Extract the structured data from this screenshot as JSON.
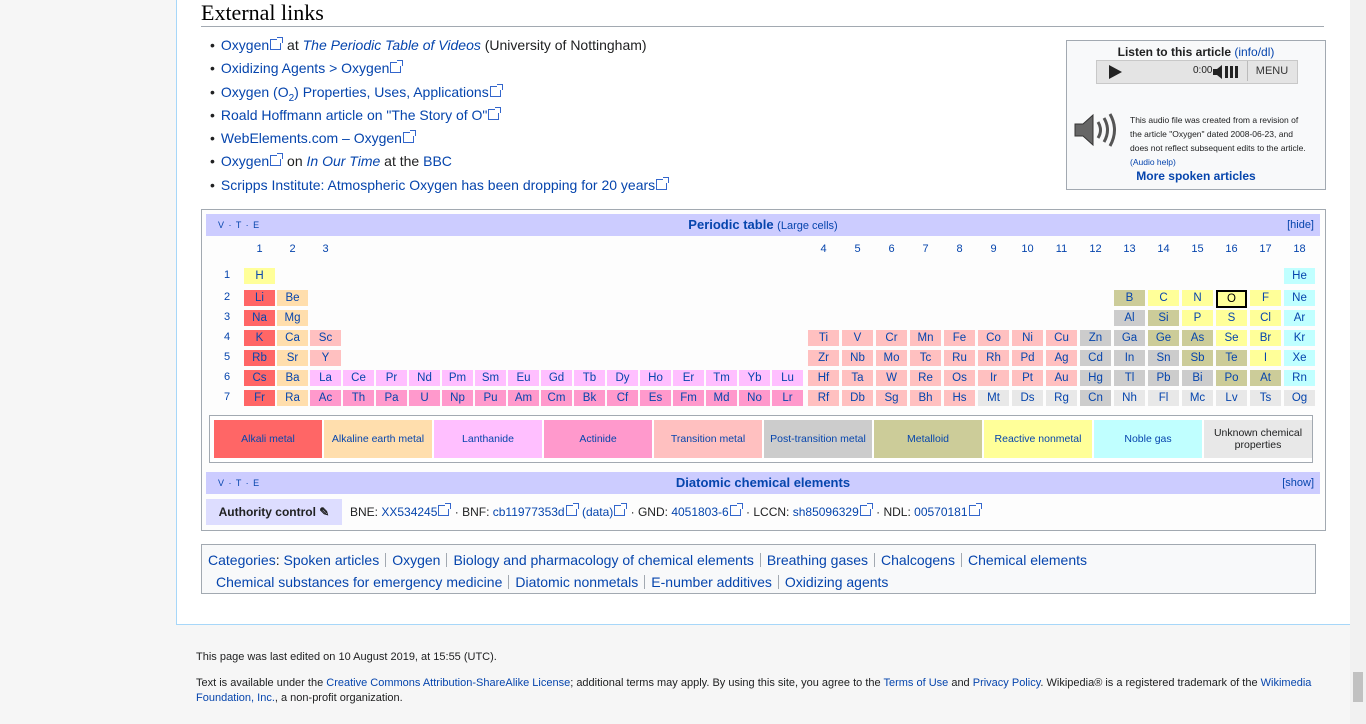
{
  "heading": "External links",
  "links": [
    {
      "parts": [
        {
          "t": "Oxygen",
          "k": "link"
        },
        {
          "t": "",
          "k": "ext"
        },
        {
          "t": " at ",
          "k": "text"
        },
        {
          "t": "The Periodic Table of Videos",
          "k": "italic-link"
        },
        {
          "t": " (University of Nottingham)",
          "k": "text"
        }
      ]
    },
    {
      "parts": [
        {
          "t": "Oxidizing Agents > Oxygen",
          "k": "link"
        },
        {
          "t": "",
          "k": "ext"
        }
      ]
    },
    {
      "parts": [
        {
          "t": "Oxygen (O",
          "k": "link"
        },
        {
          "t": "2",
          "k": "sub"
        },
        {
          "t": ") Properties, Uses, Applications",
          "k": "link"
        },
        {
          "t": "",
          "k": "ext"
        }
      ]
    },
    {
      "parts": [
        {
          "t": "Roald Hoffmann article on \"The Story of O\"",
          "k": "link"
        },
        {
          "t": "",
          "k": "ext"
        }
      ]
    },
    {
      "parts": [
        {
          "t": "WebElements.com – Oxygen",
          "k": "link"
        },
        {
          "t": "",
          "k": "ext"
        }
      ]
    },
    {
      "parts": [
        {
          "t": "Oxygen",
          "k": "link"
        },
        {
          "t": "",
          "k": "ext"
        },
        {
          "t": " on ",
          "k": "text"
        },
        {
          "t": "In Our Time",
          "k": "italic-link"
        },
        {
          "t": " at the ",
          "k": "text"
        },
        {
          "t": "BBC",
          "k": "link"
        }
      ]
    },
    {
      "parts": [
        {
          "t": "Scripps Institute: Atmospheric Oxygen has been dropping for 20 years",
          "k": "link"
        },
        {
          "t": "",
          "k": "ext"
        }
      ]
    }
  ],
  "listen": {
    "title": "Listen to this article",
    "info_link": "(info/dl)",
    "time": "0:00",
    "menu": "MENU",
    "note_parts": [
      "This audio file was created from a revision of",
      "the article \"Oxygen\" dated 2008-06-23, and",
      "does not reflect subsequent edits to the article."
    ],
    "help": "(Audio help)",
    "more": "More spoken articles"
  },
  "periodic": {
    "vte": "V · T · E",
    "title": "Periodic table",
    "subtitle": "(Large cells)",
    "hide": "[hide]",
    "groups": [
      "1",
      "2",
      "3",
      "4",
      "5",
      "6",
      "7",
      "8",
      "9",
      "10",
      "11",
      "12",
      "13",
      "14",
      "15",
      "16",
      "17",
      "18"
    ],
    "periods": [
      "1",
      "2",
      "3",
      "4",
      "5",
      "6",
      "7"
    ],
    "current": "O",
    "colors": {
      "alkali": "#ff6666",
      "alkaline": "#ffdead",
      "lanth": "#ffbfff",
      "actin": "#ff99cc",
      "trans": "#ffc0c0",
      "post": "#cccccc",
      "metalloid": "#cccc99",
      "nonmetal": "#ffff99",
      "noble": "#c0ffff",
      "unknown": "#e8e8e8"
    },
    "elements": [
      [
        "H",
        "nonmetal"
      ],
      [
        "He",
        "noble"
      ],
      [
        "Li",
        "alkali"
      ],
      [
        "Be",
        "alkaline"
      ],
      [
        "B",
        "metalloid"
      ],
      [
        "C",
        "nonmetal"
      ],
      [
        "N",
        "nonmetal"
      ],
      [
        "O",
        "nonmetal"
      ],
      [
        "F",
        "nonmetal"
      ],
      [
        "Ne",
        "noble"
      ],
      [
        "Na",
        "alkali"
      ],
      [
        "Mg",
        "alkaline"
      ],
      [
        "Al",
        "post"
      ],
      [
        "Si",
        "metalloid"
      ],
      [
        "P",
        "nonmetal"
      ],
      [
        "S",
        "nonmetal"
      ],
      [
        "Cl",
        "nonmetal"
      ],
      [
        "Ar",
        "noble"
      ],
      [
        "K",
        "alkali"
      ],
      [
        "Ca",
        "alkaline"
      ],
      [
        "Sc",
        "trans"
      ],
      [
        "Ti",
        "trans"
      ],
      [
        "V",
        "trans"
      ],
      [
        "Cr",
        "trans"
      ],
      [
        "Mn",
        "trans"
      ],
      [
        "Fe",
        "trans"
      ],
      [
        "Co",
        "trans"
      ],
      [
        "Ni",
        "trans"
      ],
      [
        "Cu",
        "trans"
      ],
      [
        "Zn",
        "post"
      ],
      [
        "Ga",
        "post"
      ],
      [
        "Ge",
        "metalloid"
      ],
      [
        "As",
        "metalloid"
      ],
      [
        "Se",
        "nonmetal"
      ],
      [
        "Br",
        "nonmetal"
      ],
      [
        "Kr",
        "noble"
      ],
      [
        "Rb",
        "alkali"
      ],
      [
        "Sr",
        "alkaline"
      ],
      [
        "Y",
        "trans"
      ],
      [
        "Zr",
        "trans"
      ],
      [
        "Nb",
        "trans"
      ],
      [
        "Mo",
        "trans"
      ],
      [
        "Tc",
        "trans"
      ],
      [
        "Ru",
        "trans"
      ],
      [
        "Rh",
        "trans"
      ],
      [
        "Pd",
        "trans"
      ],
      [
        "Ag",
        "trans"
      ],
      [
        "Cd",
        "post"
      ],
      [
        "In",
        "post"
      ],
      [
        "Sn",
        "post"
      ],
      [
        "Sb",
        "metalloid"
      ],
      [
        "Te",
        "metalloid"
      ],
      [
        "I",
        "nonmetal"
      ],
      [
        "Xe",
        "noble"
      ],
      [
        "Cs",
        "alkali"
      ],
      [
        "Ba",
        "alkaline"
      ],
      [
        "La",
        "lanth"
      ],
      [
        "Ce",
        "lanth"
      ],
      [
        "Pr",
        "lanth"
      ],
      [
        "Nd",
        "lanth"
      ],
      [
        "Pm",
        "lanth"
      ],
      [
        "Sm",
        "lanth"
      ],
      [
        "Eu",
        "lanth"
      ],
      [
        "Gd",
        "lanth"
      ],
      [
        "Tb",
        "lanth"
      ],
      [
        "Dy",
        "lanth"
      ],
      [
        "Ho",
        "lanth"
      ],
      [
        "Er",
        "lanth"
      ],
      [
        "Tm",
        "lanth"
      ],
      [
        "Yb",
        "lanth"
      ],
      [
        "Lu",
        "lanth"
      ],
      [
        "Hf",
        "trans"
      ],
      [
        "Ta",
        "trans"
      ],
      [
        "W",
        "trans"
      ],
      [
        "Re",
        "trans"
      ],
      [
        "Os",
        "trans"
      ],
      [
        "Ir",
        "trans"
      ],
      [
        "Pt",
        "trans"
      ],
      [
        "Au",
        "trans"
      ],
      [
        "Hg",
        "post"
      ],
      [
        "Tl",
        "post"
      ],
      [
        "Pb",
        "post"
      ],
      [
        "Bi",
        "post"
      ],
      [
        "Po",
        "metalloid"
      ],
      [
        "At",
        "metalloid"
      ],
      [
        "Rn",
        "noble"
      ],
      [
        "Fr",
        "alkali"
      ],
      [
        "Ra",
        "alkaline"
      ],
      [
        "Ac",
        "actin"
      ],
      [
        "Th",
        "actin"
      ],
      [
        "Pa",
        "actin"
      ],
      [
        "U",
        "actin"
      ],
      [
        "Np",
        "actin"
      ],
      [
        "Pu",
        "actin"
      ],
      [
        "Am",
        "actin"
      ],
      [
        "Cm",
        "actin"
      ],
      [
        "Bk",
        "actin"
      ],
      [
        "Cf",
        "actin"
      ],
      [
        "Es",
        "actin"
      ],
      [
        "Fm",
        "actin"
      ],
      [
        "Md",
        "actin"
      ],
      [
        "No",
        "actin"
      ],
      [
        "Lr",
        "actin"
      ],
      [
        "Rf",
        "trans"
      ],
      [
        "Db",
        "trans"
      ],
      [
        "Sg",
        "trans"
      ],
      [
        "Bh",
        "trans"
      ],
      [
        "Hs",
        "trans"
      ],
      [
        "Mt",
        "unknown"
      ],
      [
        "Ds",
        "unknown"
      ],
      [
        "Rg",
        "unknown"
      ],
      [
        "Cn",
        "post"
      ],
      [
        "Nh",
        "unknown"
      ],
      [
        "Fl",
        "unknown"
      ],
      [
        "Mc",
        "unknown"
      ],
      [
        "Lv",
        "unknown"
      ],
      [
        "Ts",
        "unknown"
      ],
      [
        "Og",
        "unknown"
      ]
    ],
    "legend": [
      [
        "Alkali metal",
        "alkali"
      ],
      [
        "Alkaline earth metal",
        "alkaline"
      ],
      [
        "Lanthanide",
        "lanth"
      ],
      [
        "Actinide",
        "actin"
      ],
      [
        "Transition metal",
        "trans"
      ],
      [
        "Post-transition metal",
        "post"
      ],
      [
        "Metalloid",
        "metalloid"
      ],
      [
        "Reactive nonmetal",
        "nonmetal"
      ],
      [
        "Noble gas",
        "noble"
      ],
      [
        "Unknown chemical properties",
        "unknown"
      ]
    ]
  },
  "diatomic": {
    "vte": "V · T · E",
    "title": "Diatomic chemical elements",
    "show": "[show]"
  },
  "authority": {
    "label": "Authority control",
    "items": [
      {
        "pre": "BNE: ",
        "link": "XX534245"
      },
      {
        "pre": " · BNF: ",
        "link": "cb11977353d"
      },
      {
        "pre": " ",
        "link": "(data)"
      },
      {
        "pre": " · GND: ",
        "link": "4051803-6"
      },
      {
        "pre": " · LCCN: ",
        "link": "sh85096329"
      },
      {
        "pre": " · NDL: ",
        "link": "00570181"
      }
    ]
  },
  "categories": {
    "label": "Categories",
    "items": [
      "Spoken articles",
      "Oxygen",
      "Biology and pharmacology of chemical elements",
      "Breathing gases",
      "Chalcogens",
      "Chemical elements",
      "Chemical substances for emergency medicine",
      "Diatomic nonmetals",
      "E-number additives",
      "Oxidizing agents"
    ]
  },
  "footer": {
    "edited": "This page was last edited on 10 August 2019, at 15:55 (UTC).",
    "license_parts": [
      {
        "t": "Text is available under the ",
        "k": "text"
      },
      {
        "t": "Creative Commons Attribution-ShareAlike License",
        "k": "link"
      },
      {
        "t": "; additional terms may apply. By using this site, you agree to the ",
        "k": "text"
      },
      {
        "t": "Terms of Use",
        "k": "link"
      },
      {
        "t": " and ",
        "k": "text"
      },
      {
        "t": "Privacy Policy",
        "k": "link"
      },
      {
        "t": ". Wikipedia® is a registered trademark of the ",
        "k": "text"
      },
      {
        "t": "Wikimedia Foundation, Inc.",
        "k": "link"
      },
      {
        "t": ", a non-profit organization.",
        "k": "text"
      }
    ]
  }
}
